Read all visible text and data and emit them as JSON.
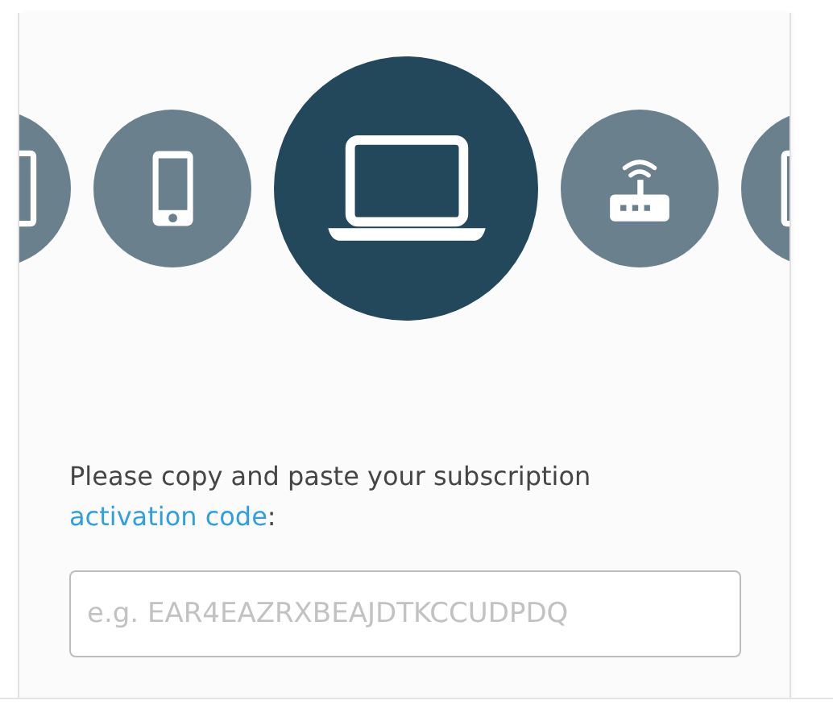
{
  "devices": [
    {
      "kind": "tablet",
      "selected": false
    },
    {
      "kind": "phone",
      "selected": false
    },
    {
      "kind": "laptop",
      "selected": true
    },
    {
      "kind": "router",
      "selected": false
    },
    {
      "kind": "tablet",
      "selected": false
    }
  ],
  "prompt": {
    "text": "Please copy and paste your subscription",
    "link": "activation code",
    "suffix": ":"
  },
  "code_field": {
    "placeholder": "e.g. EAR4EAZRXBEAJDTKCCUDPDQ"
  }
}
